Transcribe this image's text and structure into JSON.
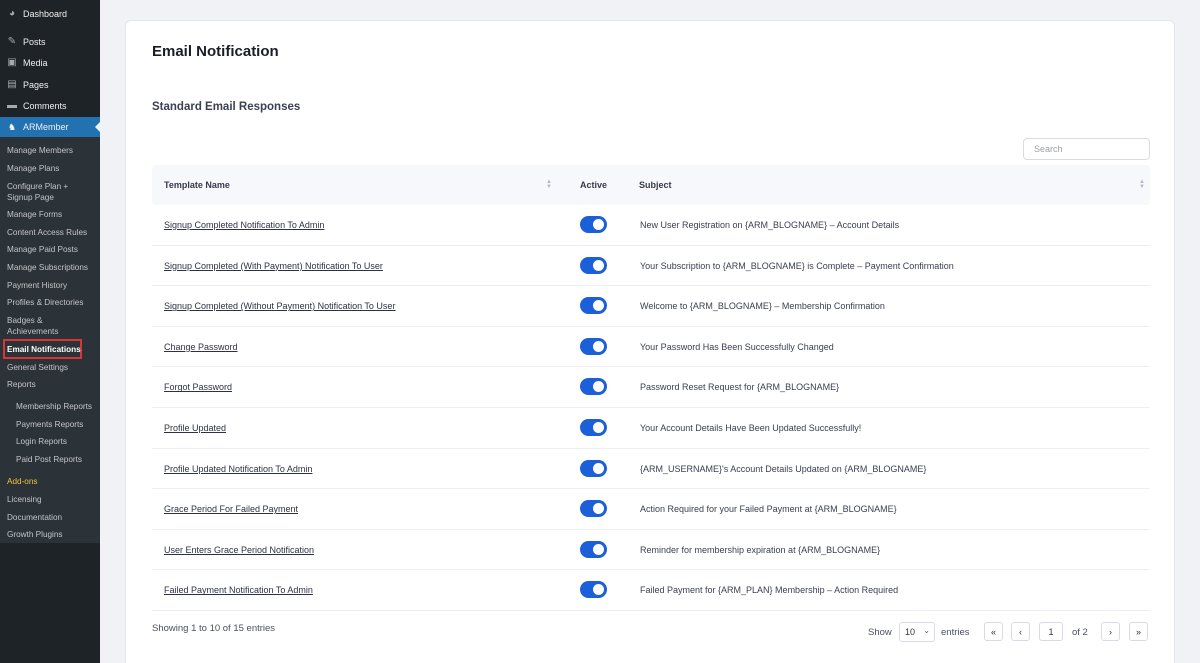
{
  "sidebar": {
    "top_items": [
      {
        "label": "Dashboard",
        "icon": "dashboard-icon"
      },
      {
        "label": "Posts",
        "icon": "pin-icon"
      },
      {
        "label": "Media",
        "icon": "media-icon"
      },
      {
        "label": "Pages",
        "icon": "pages-icon"
      },
      {
        "label": "Comments",
        "icon": "comment-icon"
      }
    ],
    "active_label": "ARMember",
    "submenu": [
      "Manage Members",
      "Manage Plans",
      "Configure Plan +",
      "Signup Page",
      "Manage Forms",
      "Content Access Rules",
      "Manage Paid Posts",
      "Manage Subscriptions",
      "Payment History",
      "Profiles & Directories",
      "Badges &",
      "Achievements",
      "Email Notifications",
      "General Settings",
      "Reports",
      "Membership Reports",
      "Payments Reports",
      "Login Reports",
      "Paid Post Reports",
      "Add-ons",
      "Licensing",
      "Documentation",
      "Growth Plugins"
    ]
  },
  "main": {
    "title": "Email Notification",
    "section_title": "Standard Email Responses",
    "search_placeholder": "Search",
    "columns": {
      "name": "Template Name",
      "active": "Active",
      "subject": "Subject"
    },
    "rows": [
      {
        "name": "Signup Completed Notification To Admin",
        "active": true,
        "subject": "New User Registration on {ARM_BLOGNAME} – Account Details"
      },
      {
        "name": "Signup Completed (With Payment) Notification To User",
        "active": true,
        "subject": "Your Subscription to {ARM_BLOGNAME} is Complete – Payment Confirmation"
      },
      {
        "name": "Signup Completed (Without Payment) Notification To User",
        "active": true,
        "subject": "Welcome to {ARM_BLOGNAME} – Membership Confirmation"
      },
      {
        "name": "Change Password",
        "active": true,
        "subject": "Your Password Has Been Successfully Changed"
      },
      {
        "name": "Forgot Password",
        "active": true,
        "subject": "Password Reset Request for {ARM_BLOGNAME}"
      },
      {
        "name": "Profile Updated",
        "active": true,
        "subject": "Your Account Details Have Been Updated Successfully!"
      },
      {
        "name": "Profile Updated Notification To Admin",
        "active": true,
        "subject": "{ARM_USERNAME}'s Account Details Updated on {ARM_BLOGNAME}"
      },
      {
        "name": "Grace Period For Failed Payment",
        "active": true,
        "subject": "Action Required for your Failed Payment at {ARM_BLOGNAME}"
      },
      {
        "name": "User Enters Grace Period Notification",
        "active": true,
        "subject": "Reminder for membership expiration at {ARM_BLOGNAME}"
      },
      {
        "name": "Failed Payment Notification To Admin",
        "active": true,
        "subject": "Failed Payment for {ARM_PLAN} Membership – Action Required"
      }
    ],
    "footer": {
      "info": "Showing 1 to 10 of 15 entries",
      "show_label": "Show",
      "page_length": "10",
      "entries_label": "entries",
      "current_page": "1",
      "of_pages": "of 2",
      "first": "«",
      "prev": "‹",
      "next": "›",
      "last": "»"
    }
  }
}
